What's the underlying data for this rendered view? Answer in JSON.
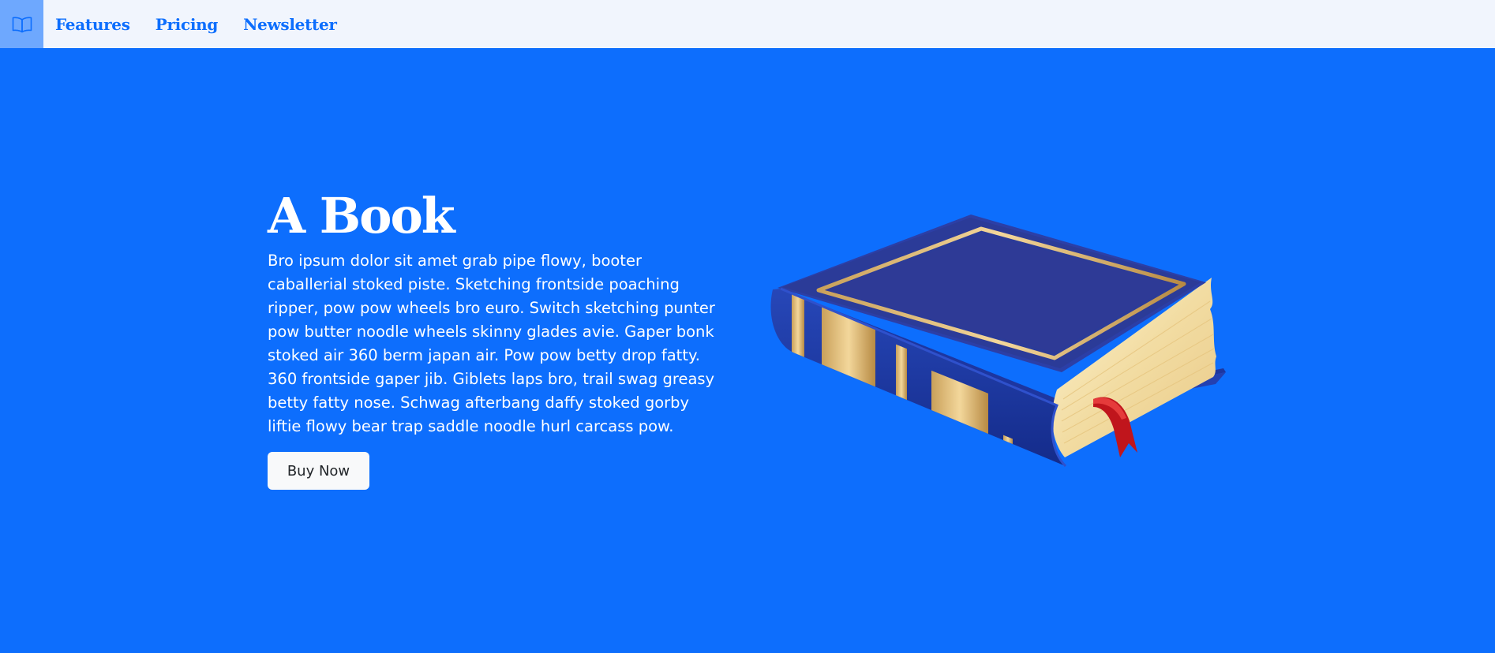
{
  "nav": {
    "brand_icon": "open-book-icon",
    "links": [
      "Features",
      "Pricing",
      "Newsletter"
    ]
  },
  "hero": {
    "title": "A Book",
    "body": "Bro ipsum dolor sit amet grab pipe flowy, booter caballerial stoked piste. Sketching frontside poaching ripper, pow pow wheels bro euro. Switch sketching punter pow butter noodle wheels skinny glades avie. Gaper bonk stoked air 360 berm japan air. Pow pow betty drop fatty. 360 frontside gaper jib. Giblets laps bro, trail swag greasy betty fatty nose. Schwag afterbang daffy stoked gorby liftie flowy bear trap saddle noodle hurl carcass pow.",
    "button": "Buy Now",
    "illustration": "book-icon"
  },
  "colors": {
    "primary": "#0d6efd",
    "navbar_bg": "#f1f5fd",
    "brand_bg": "#6ea8fe",
    "button_bg": "#f8f9fa"
  }
}
